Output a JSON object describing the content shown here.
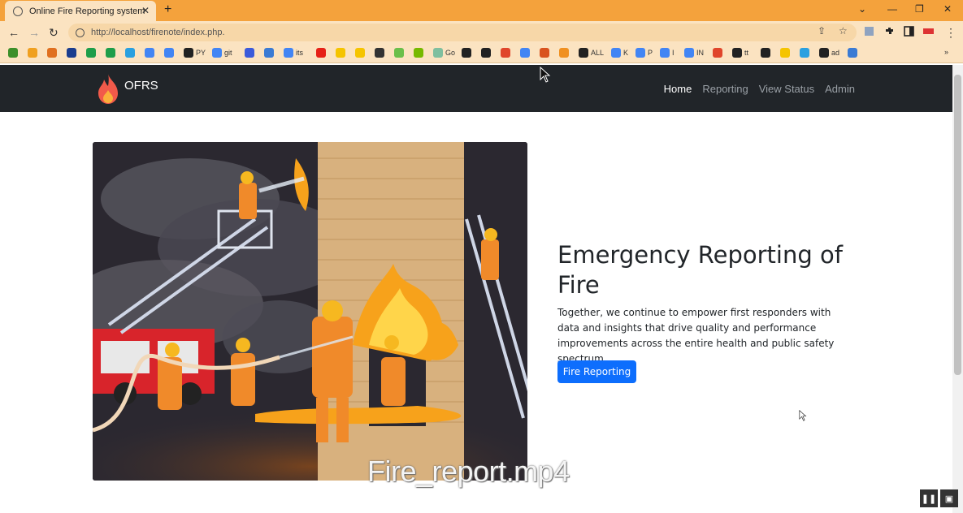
{
  "browser": {
    "tab_title": "Online Fire Reporting system",
    "tab_close": "✕",
    "new_tab": "+",
    "url": "http://localhost/firenote/index.php.",
    "window_controls": [
      "⌄",
      "—",
      "❐",
      "✕"
    ],
    "bookmarks": [
      {
        "label": "",
        "color": "#3c8f2a"
      },
      {
        "label": "",
        "color": "#f0a020"
      },
      {
        "label": "",
        "color": "#e07020"
      },
      {
        "label": "",
        "color": "#1a3d8f"
      },
      {
        "label": "",
        "color": "#1e9e4a"
      },
      {
        "label": "",
        "color": "#1e9e4a"
      },
      {
        "label": "",
        "color": "#2aa0e0"
      },
      {
        "label": "",
        "color": "#4285f4"
      },
      {
        "label": "",
        "color": "#4285f4"
      },
      {
        "label": "PY",
        "color": "#222"
      },
      {
        "label": "git",
        "color": "#4285f4"
      },
      {
        "label": "",
        "color": "#3b5bdb"
      },
      {
        "label": "",
        "color": "#3b7bd4"
      },
      {
        "label": "its",
        "color": "#4285f4"
      },
      {
        "label": "",
        "color": "#e62117"
      },
      {
        "label": "",
        "color": "#f5c400"
      },
      {
        "label": "",
        "color": "#f5c400"
      },
      {
        "label": "",
        "color": "#333"
      },
      {
        "label": "",
        "color": "#6abf4b"
      },
      {
        "label": "",
        "color": "#76b900"
      },
      {
        "label": "Go",
        "color": "#7fbf9f"
      },
      {
        "label": "",
        "color": "#222"
      },
      {
        "label": "",
        "color": "#222"
      },
      {
        "label": "",
        "color": "#e0452b"
      },
      {
        "label": "",
        "color": "#4285f4"
      },
      {
        "label": "",
        "color": "#d9531e"
      },
      {
        "label": "",
        "color": "#f09020"
      },
      {
        "label": "ALL",
        "color": "#222"
      },
      {
        "label": "K",
        "color": "#4285f4"
      },
      {
        "label": "P",
        "color": "#4285f4"
      },
      {
        "label": "I",
        "color": "#4285f4"
      },
      {
        "label": "IN",
        "color": "#4285f4"
      },
      {
        "label": "",
        "color": "#e0452b"
      },
      {
        "label": "tt",
        "color": "#222"
      },
      {
        "label": "",
        "color": "#222"
      },
      {
        "label": "",
        "color": "#f5c400"
      },
      {
        "label": "",
        "color": "#2aa0e0"
      },
      {
        "label": "ad",
        "color": "#222"
      },
      {
        "label": "",
        "color": "#3b7bd4"
      }
    ],
    "more_bookmarks": "»"
  },
  "site": {
    "brand": "OFRS",
    "nav": [
      {
        "label": "Home",
        "active": true
      },
      {
        "label": "Reporting",
        "active": false
      },
      {
        "label": "View Status",
        "active": false
      },
      {
        "label": "Admin",
        "active": false
      }
    ],
    "hero": {
      "heading": "Emergency Reporting of Fire",
      "body": "Together, we continue to empower first responders with data and insights that drive quality and performance improvements across the entire health and public safety spectrum.",
      "button": "Fire Reporting"
    }
  },
  "overlay": {
    "watermark": "Fire_report.mp4",
    "pause_icon": "❚❚",
    "pip_icon": "▣"
  },
  "colors": {
    "navbar": "#212529",
    "primary": "#0d6efd",
    "tabbar": "#f4a23c"
  }
}
